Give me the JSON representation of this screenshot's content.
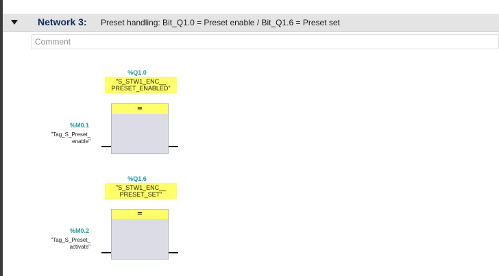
{
  "network": {
    "title": "Network 3:",
    "description": "Preset handling: Bit_Q1.0 = Preset enable / Bit_Q1.6 = Preset set",
    "comment_placeholder": "Comment"
  },
  "rungs": [
    {
      "coil_address": "%Q1.0",
      "coil_tag_line1": "\"S_STW1_ENC__",
      "coil_tag_line2": "PRESET_ENABLED\"",
      "coil_symbol": "=",
      "input_address": "%M0.1",
      "input_tag_line1": "\"Tag_S_Preset_",
      "input_tag_line2": "enable\""
    },
    {
      "coil_address": "%Q1.6",
      "coil_tag_line1": "\"S_STW1_ENC__",
      "coil_tag_line2": "PRESET_SET\"",
      "coil_symbol": "=",
      "input_address": "%M0.2",
      "input_tag_line1": "\"Tag_S_Preset_",
      "input_tag_line2": "activate\""
    }
  ],
  "colors": {
    "header_bg": "#e4e4e4",
    "address_teal": "#1f9a9a",
    "tag_yellow": "#ffff66",
    "box_gray": "#dcdce6"
  }
}
